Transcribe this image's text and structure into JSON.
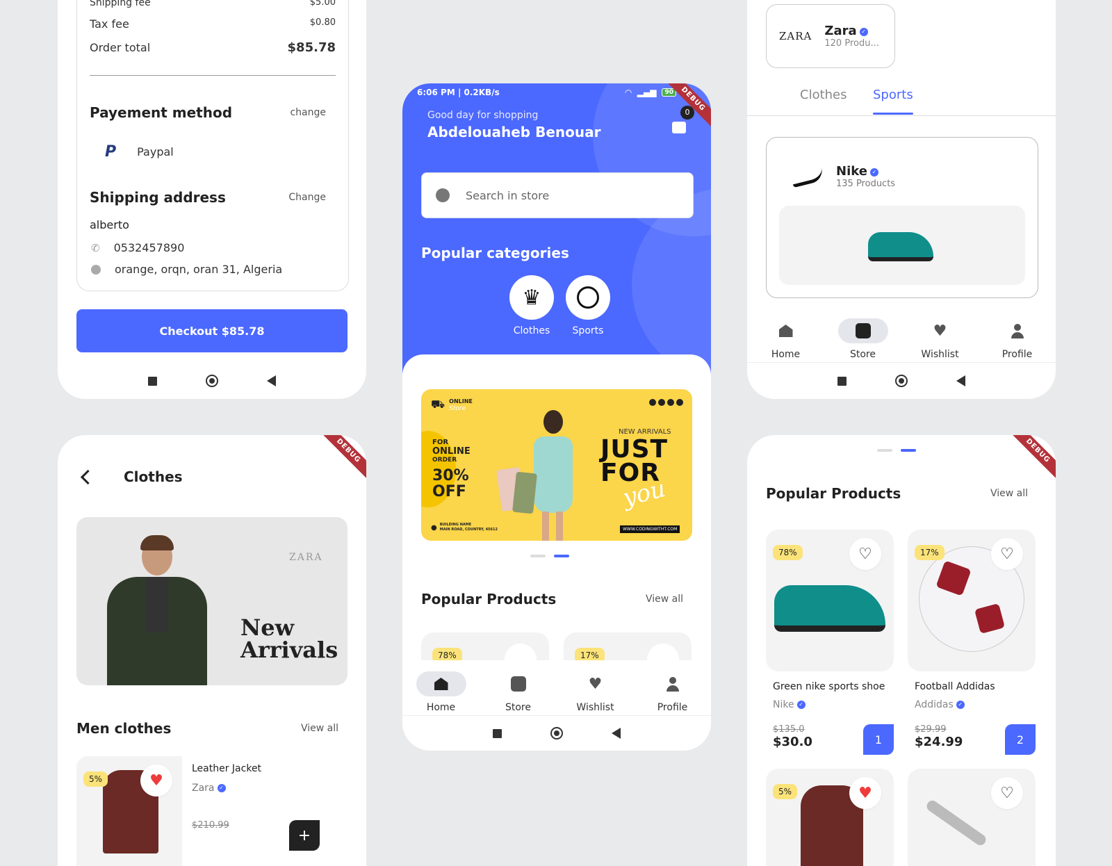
{
  "checkout": {
    "shipping_fee_label": "Shipping fee",
    "shipping_fee_value": "$5.00",
    "tax_fee_label": "Tax fee",
    "tax_fee_value": "$0.80",
    "order_total_label": "Order total",
    "order_total_value": "$85.78",
    "payment_title": "Payement method",
    "payment_change": "change",
    "payment_method": "Paypal",
    "shipping_title": "Shipping address",
    "shipping_change": "Change",
    "name": "alberto",
    "phone": "0532457890",
    "address": "orange, orqn, oran 31, Algeria",
    "checkout_button": "Checkout $85.78"
  },
  "home": {
    "status_left": "6:06 PM | 0.2KB/s",
    "battery": "90",
    "greeting": "Good day for shopping",
    "user_name": "Abdelouaheb Benouar",
    "cart_count": "0",
    "search_placeholder": "Search in store",
    "categories_title": "Popular categories",
    "categories": [
      "Clothes",
      "Sports"
    ],
    "banner": {
      "brand_line1": "ONLINE",
      "brand_line2": "Store",
      "promo_for": "FOR",
      "promo_online": "ONLINE",
      "promo_order": "ORDER",
      "promo_pct": "30%",
      "promo_off": "OFF",
      "new_arrivals": "NEW ARRIVALS",
      "headline1": "JUST",
      "headline2": "FOR",
      "headline3": "you",
      "address1": "BUILDING NAME",
      "address2": "MAIN ROAD, COUNTRY, 45612",
      "website": "WWW.CODINGWITHT.COM"
    },
    "popular_title": "Popular Products",
    "view_all": "View all",
    "peek_badges": [
      "78%",
      "17%"
    ],
    "tabs": [
      "Home",
      "Store",
      "Wishlist",
      "Profile"
    ]
  },
  "store": {
    "brand_name": "Zara",
    "brand_logo": "ZARA",
    "brand_products": "120 Produ...",
    "tabs": [
      "Clothes",
      "Sports"
    ],
    "active_tab": "Sports",
    "nike_name": "Nike",
    "nike_products": "135 Products",
    "bottom_tabs": [
      "Home",
      "Store",
      "Wishlist",
      "Profile"
    ]
  },
  "clothes_page": {
    "title": "Clothes",
    "banner_brand": "ZARA",
    "banner_text1": "New",
    "banner_text2": "Arrivals",
    "section_title": "Men clothes",
    "view_all": "View all",
    "item_badge": "5%",
    "item_name": "Leather Jacket",
    "item_brand": "Zara",
    "item_old_price": "$210.99",
    "add_icon": "+"
  },
  "popular_page": {
    "title": "Popular Products",
    "view_all": "View all",
    "products": [
      {
        "badge": "78%",
        "name": "Green nike sports shoe",
        "brand": "Nike",
        "old_price": "$135.0",
        "price": "$30.0",
        "qty": "1"
      },
      {
        "badge": "17%",
        "name": "Football Addidas",
        "brand": "Addidas",
        "old_price": "$29.99",
        "price": "$24.99",
        "qty": "2"
      }
    ],
    "row2_badge": "5%"
  },
  "colors": {
    "primary": "#4b68ff",
    "badge_yellow": "#fbe37a",
    "heart_red": "#ee3b3b"
  }
}
